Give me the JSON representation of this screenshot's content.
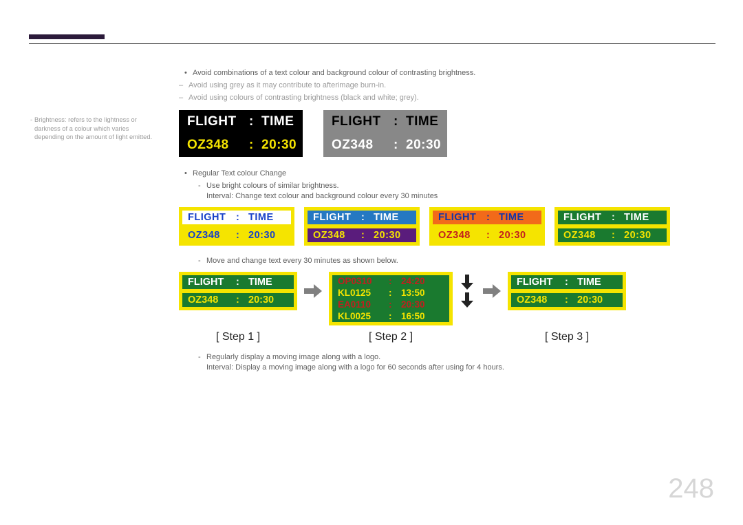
{
  "sidenote": "Brightness: refers to the lightness or darkness of a colour which varies depending on the amount of light emitted.",
  "bullet1": "Avoid combinations of a text colour and background colour of contrasting brightness.",
  "dash1": "Avoid using grey as it may contribute to afterimage burn-in.",
  "dash2": "Avoid using colours of contrasting brightness (black and white; grey).",
  "display": {
    "flight_label": "FLIGHT",
    "time_label": "TIME",
    "flight_value": "OZ348",
    "time_value": "20:30"
  },
  "bullet2": "Regular Text colour Change",
  "subdash_a": "Use bright colours of similar brightness.",
  "subplain_a": "Interval: Change text colour and background colour every 30 minutes",
  "subdash_b": "Move and change text every 30 minutes as shown below.",
  "step2_rows": [
    {
      "id": "OP0310",
      "time": "24:20",
      "cls": "red"
    },
    {
      "id": "KL0125",
      "time": "13:50",
      "cls": "yellow"
    },
    {
      "id": "EA0110",
      "time": "20:30",
      "cls": "red"
    },
    {
      "id": "KL0025",
      "time": "16:50",
      "cls": "yellow"
    }
  ],
  "step_labels": {
    "s1": "[ Step 1 ]",
    "s2": "[ Step 2 ]",
    "s3": "[ Step 3 ]"
  },
  "subdash_c": "Regularly display a moving image along with a logo.",
  "subplain_c": "Interval: Display a moving image along with a logo for 60 seconds after using for 4 hours.",
  "page_number": "248"
}
